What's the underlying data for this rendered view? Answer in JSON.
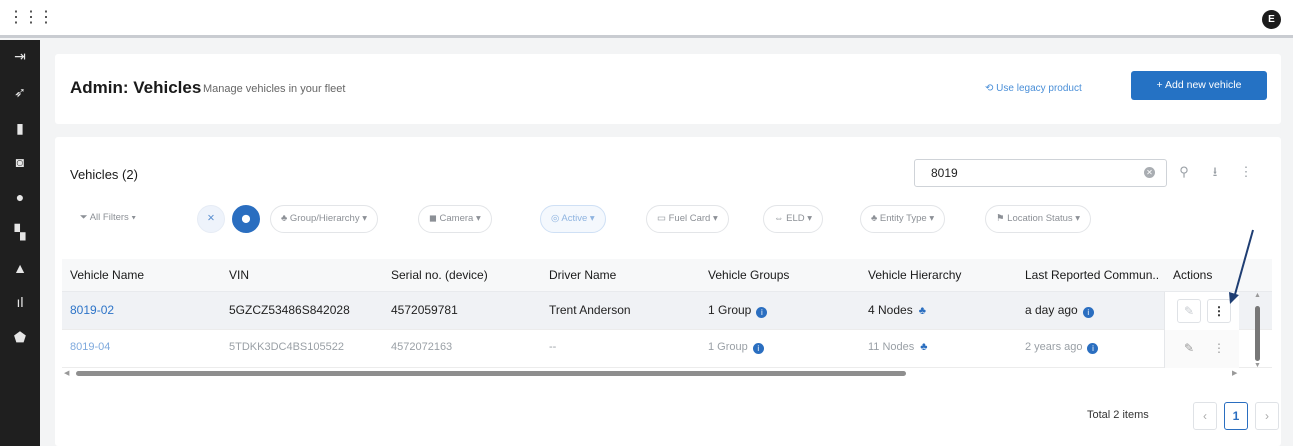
{
  "topbar": {
    "user_initial": "E"
  },
  "sidebar": {
    "items": [
      {
        "icon": "sign-in-icon"
      },
      {
        "icon": "rocket-icon"
      },
      {
        "icon": "map-icon"
      },
      {
        "icon": "camera-icon"
      },
      {
        "icon": "compass-icon"
      },
      {
        "icon": "dashboard-icon"
      },
      {
        "icon": "bell-icon"
      },
      {
        "icon": "bar-chart-icon"
      },
      {
        "icon": "shield-icon"
      }
    ]
  },
  "header": {
    "title": "Admin: Vehicles",
    "subtitle": "Manage vehicles in your fleet",
    "legacy_link": "Use legacy product",
    "add_button": "+ Add new vehicle"
  },
  "list": {
    "title": "Vehicles (2)",
    "search_value": "8019",
    "filters": [
      "All Filters",
      "Group/Hierarchy",
      "Camera",
      "Active",
      "Fuel Card",
      "ELD",
      "Entity Type",
      "Location Status"
    ],
    "columns": [
      "Vehicle Name",
      "VIN",
      "Serial no. (device)",
      "Driver Name",
      "Vehicle Groups",
      "Vehicle Hierarchy",
      "Last Reported Commun...",
      "Actions"
    ],
    "rows": [
      {
        "name": "8019-02",
        "vin": "5GZCZ53486S842028",
        "serial": "4572059781",
        "driver": "Trent Anderson",
        "groups": "1 Group",
        "hierarchy": "4 Nodes",
        "last": "a day ago"
      },
      {
        "name": "8019-04",
        "vin": "5TDKK3DC4BS105522",
        "serial": "4572072163",
        "driver": "--",
        "groups": "1 Group",
        "hierarchy": "11 Nodes",
        "last": "2 years ago"
      }
    ],
    "total": "Total 2 items",
    "current_page": "1"
  },
  "colors": {
    "accent": "#2572c4",
    "sidebar": "#1f1f1f"
  }
}
